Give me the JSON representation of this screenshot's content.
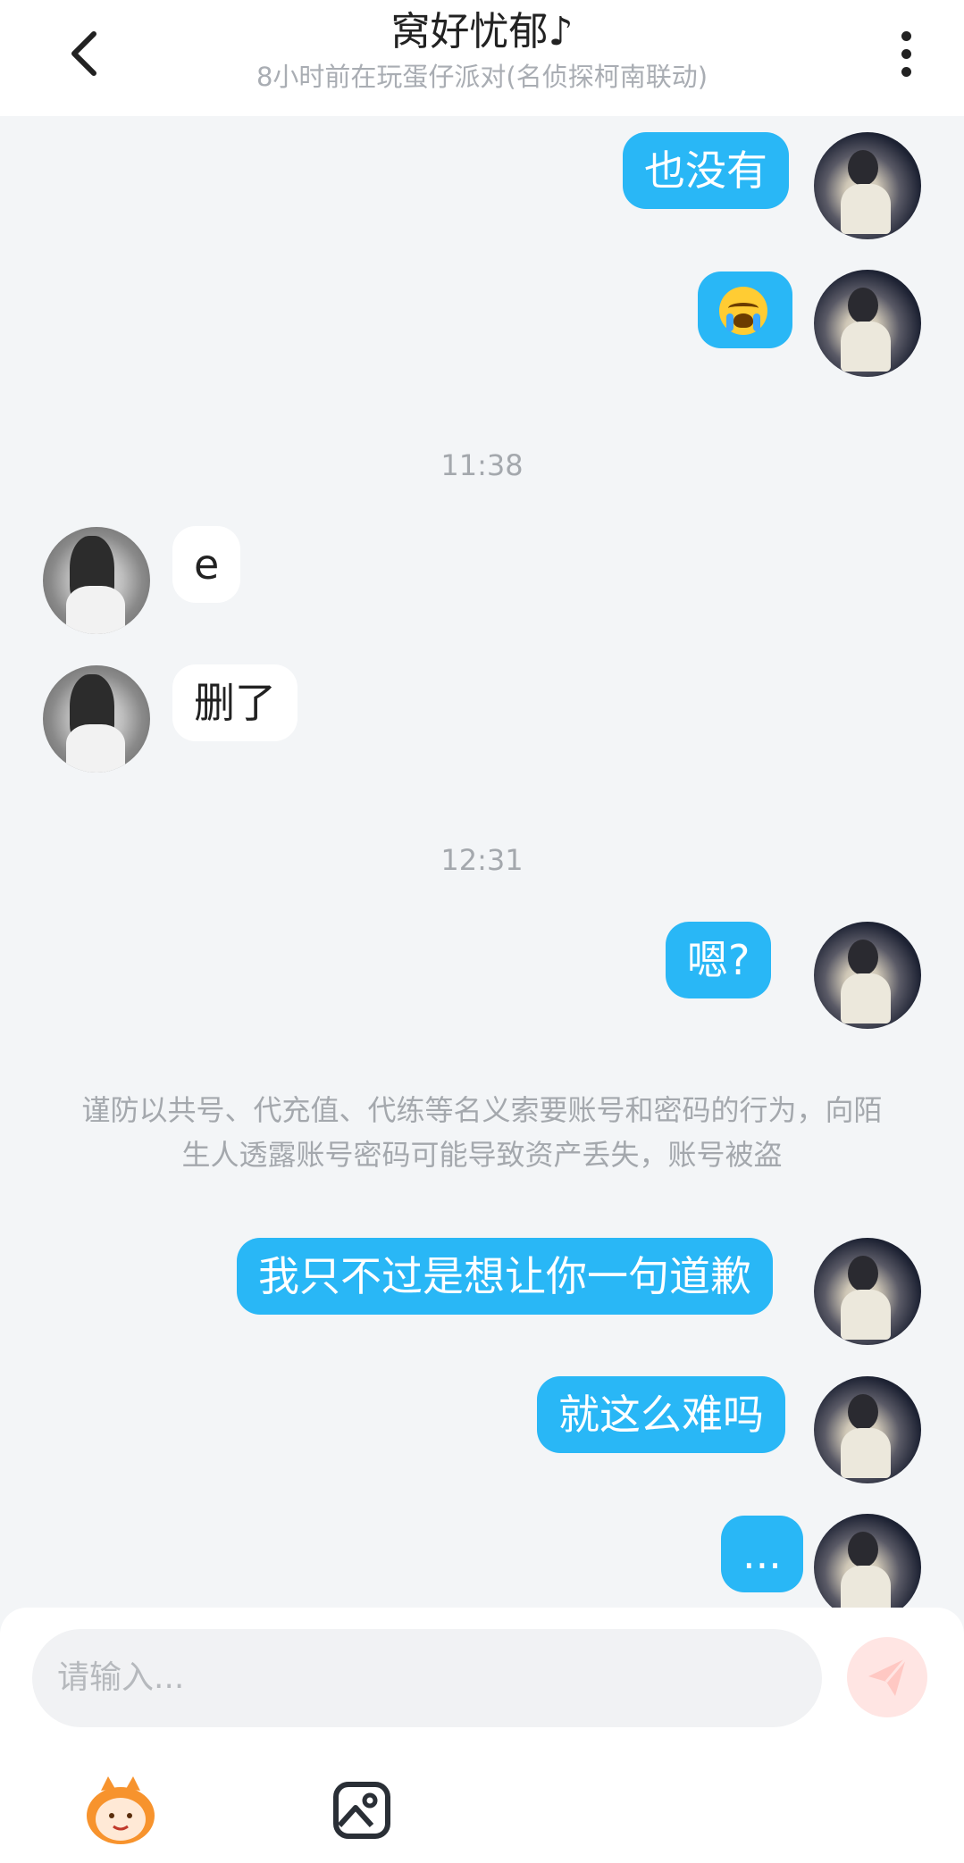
{
  "header": {
    "title": "窝好忧郁♪",
    "subtitle": "8小时前在玩蛋仔派对(名侦探柯南联动)"
  },
  "messages": [
    {
      "sender": "me",
      "text": "也没有"
    },
    {
      "sender": "me",
      "text": "",
      "emoji": "loudly-crying-face-emoji"
    },
    {
      "timestamp": "11:38"
    },
    {
      "sender": "them",
      "text": "e"
    },
    {
      "sender": "them",
      "text": "删了"
    },
    {
      "timestamp": "12:31"
    },
    {
      "sender": "me",
      "text": "嗯?"
    },
    {
      "notice": "谨防以共号、代充值、代练等名义索要账号和密码的行为，向陌生人透露账号密码可能导致资产丢失，账号被盗"
    },
    {
      "sender": "me",
      "text": "我只不过是想让你一句道歉"
    },
    {
      "sender": "me",
      "text": "就这么难吗"
    },
    {
      "sender": "me",
      "text": "..."
    }
  ],
  "composer": {
    "placeholder": "请输入..."
  },
  "colors": {
    "my_bubble": "#29b7f6",
    "their_bubble": "#ffffff",
    "background": "#f3f5f7",
    "send_button": "#ffe5e3"
  },
  "icons": {
    "back": "chevron-left-icon",
    "more": "more-vertical-icon",
    "send": "paper-plane-icon",
    "sticker": "eggy-mascot-icon",
    "image": "image-icon"
  }
}
